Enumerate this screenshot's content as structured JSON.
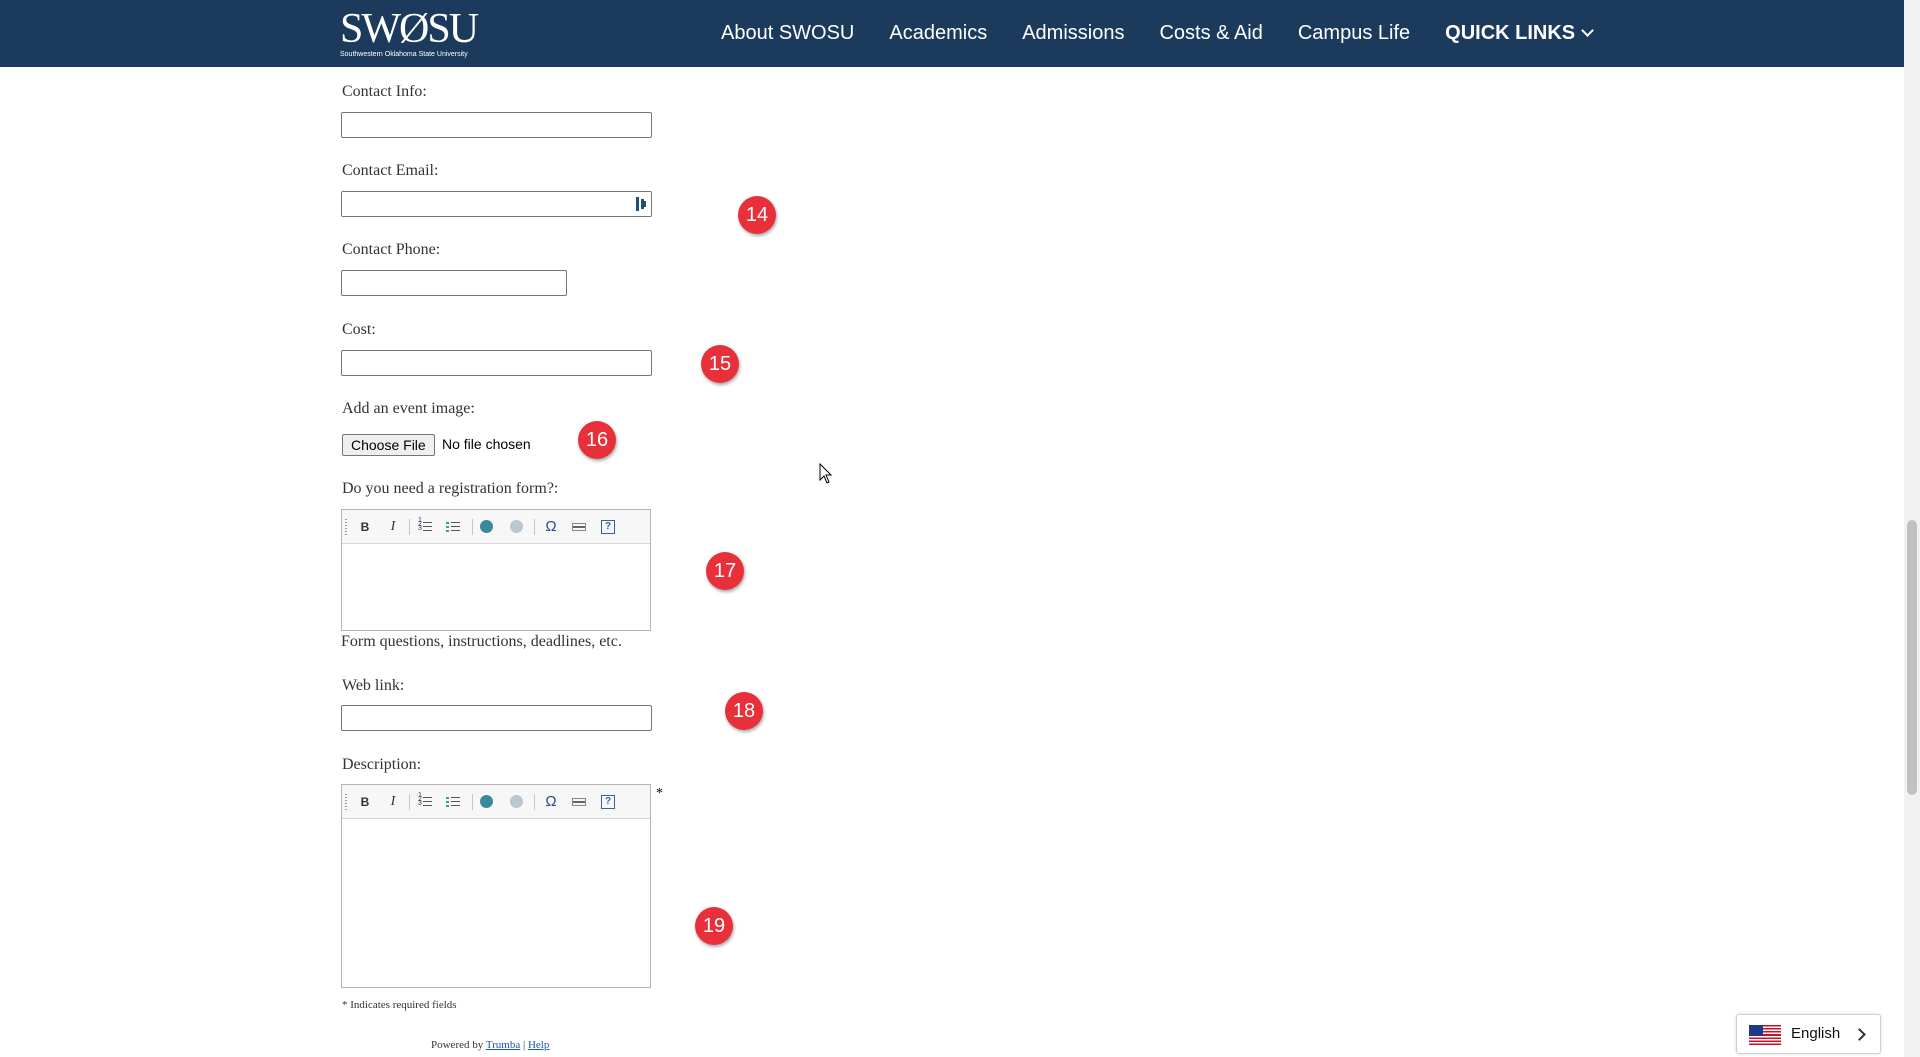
{
  "header": {
    "logo_main": "SWØSU",
    "logo_sub": "Southwestern Oklahoma State University",
    "nav": [
      "About SWOSU",
      "Academics",
      "Admissions",
      "Costs & Aid",
      "Campus Life"
    ],
    "quick_links": "QUICK LINKS"
  },
  "form": {
    "contact_info_label": "Contact Info:",
    "contact_email_label": "Contact Email:",
    "contact_phone_label": "Contact Phone:",
    "cost_label": "Cost:",
    "image_label": "Add an event image:",
    "choose_file": "Choose File",
    "file_status": "No file chosen",
    "registration_label": "Do you need a registration form?:",
    "registration_hint": "Form questions, instructions, deadlines, etc.",
    "web_link_label": "Web link:",
    "description_label": "Description:",
    "required_star": "*",
    "required_note": "* Indicates required fields",
    "toolbar": {
      "bold": "B",
      "italic": "I",
      "omega": "Ω",
      "help": "?"
    }
  },
  "footer": {
    "powered_by": "Powered by",
    "trumba": "Trumba",
    "separator": "|",
    "help": "Help"
  },
  "badges": [
    "14",
    "15",
    "16",
    "17",
    "18",
    "19"
  ],
  "language": {
    "selected": "English",
    "flag": "us-flag-icon"
  },
  "colors": {
    "header_bg": "#1b3a5c",
    "badge": "#e8303a",
    "link": "#1a56b0"
  }
}
